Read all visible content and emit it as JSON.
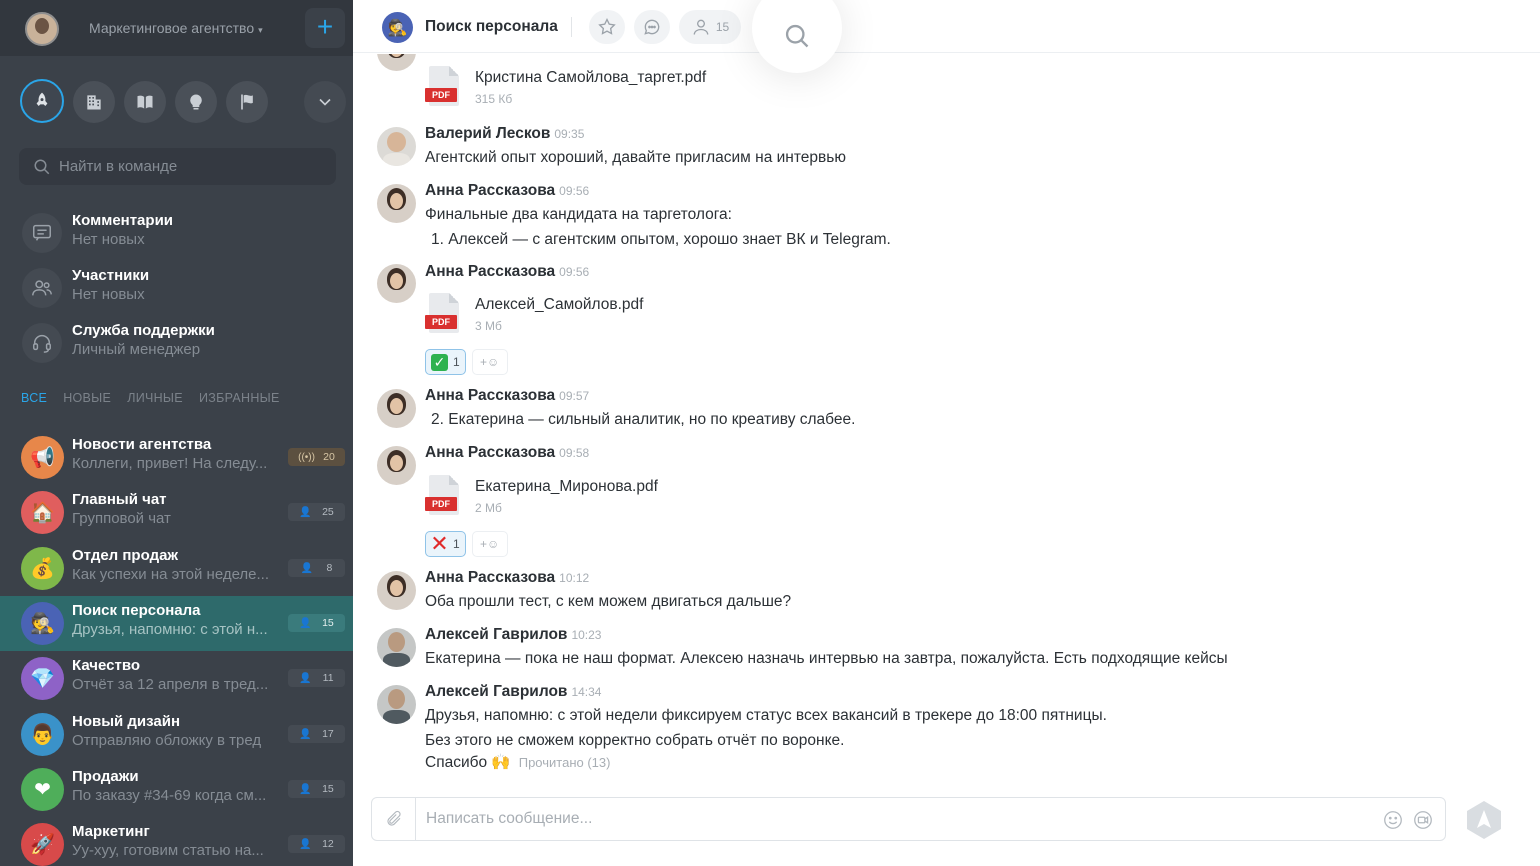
{
  "sidebar": {
    "team_name": "Маркетинговое агентство",
    "add_label": "+",
    "search_placeholder": "Найти в команде",
    "system": [
      {
        "title": "Комментарии",
        "subtitle": "Нет новых",
        "icon": "comments-icon"
      },
      {
        "title": "Участники",
        "subtitle": "Нет новых",
        "icon": "members-icon"
      },
      {
        "title": "Служба поддержки",
        "subtitle": "Личный менеджер",
        "icon": "support-icon"
      }
    ],
    "filters": [
      "ВСЕ",
      "НОВЫЕ",
      "ЛИЧНЫЕ",
      "ИЗБРАННЫЕ"
    ],
    "chats": [
      {
        "title": "Новости агентства",
        "preview": "Коллеги, привет! На следу...",
        "count": "20",
        "emoji": "📢",
        "color": "#e7874a",
        "badge_icon": "broadcast-icon"
      },
      {
        "title": "Главный чат",
        "preview": "Групповой чат",
        "count": "25",
        "emoji": "🏠",
        "color": "#e05e5e",
        "badge_icon": "person-icon"
      },
      {
        "title": "Отдел продаж",
        "preview": "Как успехи на этой неделе...",
        "count": "8",
        "emoji": "💰",
        "color": "#7fb84a",
        "badge_icon": "person-icon"
      },
      {
        "title": "Поиск персонала",
        "preview": "Друзья, напомню: с этой н...",
        "count": "15",
        "emoji": "🕵",
        "color": "#4a63b5",
        "badge_icon": "person-icon"
      },
      {
        "title": "Качество",
        "preview": "Отчёт за 12 апреля в тред...",
        "count": "11",
        "emoji": "💎",
        "color": "#8e62c7",
        "badge_icon": "person-icon"
      },
      {
        "title": "Новый дизайн",
        "preview": "Отправляю обложку в тред",
        "count": "17",
        "emoji": "👨",
        "color": "#3a92c9",
        "badge_icon": "person-icon"
      },
      {
        "title": "Продажи",
        "preview": "По заказу #34-69 когда см...",
        "count": "15",
        "emoji": "❤",
        "color": "#4fae5a",
        "badge_icon": "person-icon"
      },
      {
        "title": "Маркетинг",
        "preview": "Уу-хуу, готовим статью на...",
        "count": "12",
        "emoji": "🚀",
        "color": "#d84a4a",
        "badge_icon": "person-icon"
      }
    ]
  },
  "header": {
    "title": "Поиск персонала",
    "members_count": "15",
    "accent": "#2aa5e8"
  },
  "messages": [
    {
      "file": {
        "name": "Кристина Самойлова_таргет.pdf",
        "size": "315 Кб",
        "tag": "PDF"
      }
    },
    {
      "author": "Валерий Лесков",
      "time": "09:35",
      "text": "Агентский опыт хороший, давайте пригласим на интервью"
    },
    {
      "author": "Анна Рассказова",
      "time": "09:56",
      "text": "Финальные два кандидата на таргетолога:",
      "text2": "1. Алексей — с агентским опытом, хорошо знает ВК и Telegram."
    },
    {
      "author": "Анна Рассказова",
      "time": "09:56",
      "file": {
        "name": "Алексей_Самойлов.pdf",
        "size": "3 Мб",
        "tag": "PDF"
      },
      "reaction": {
        "mark": "✓",
        "count": "1"
      }
    },
    {
      "author": "Анна Рассказова",
      "time": "09:57",
      "text": "2. Екатерина — сильный аналитик, но по креативу слабее."
    },
    {
      "author": "Анна Рассказова",
      "time": "09:58",
      "file": {
        "name": "Екатерина_Миронова.pdf",
        "size": "2 Мб",
        "tag": "PDF"
      },
      "reaction": {
        "mark": "✕",
        "count": "1"
      }
    },
    {
      "author": "Анна Рассказова",
      "time": "10:12",
      "text": "Оба прошли тест, с кем можем двигаться дальше?"
    },
    {
      "author": "Алексей Гаврилов",
      "time": "10:23",
      "text": "Екатерина — пока не наш формат. Алексею назначь интервью на завтра, пожалуйста. Есть подходящие кейсы"
    },
    {
      "author": "Алексей Гаврилов",
      "time": "14:34",
      "text": "Друзья, напомню: с этой недели фиксируем статус всех вакансий в трекере до 18:00 пятницы.",
      "text2": "Без этого не сможем корректно собрать отчёт по воронке.",
      "text3": "Спасибо 🙌",
      "read_status": "Прочитано (13)"
    }
  ],
  "reaction_add_label": "+☺",
  "composer": {
    "placeholder": "Написать сообщение..."
  }
}
